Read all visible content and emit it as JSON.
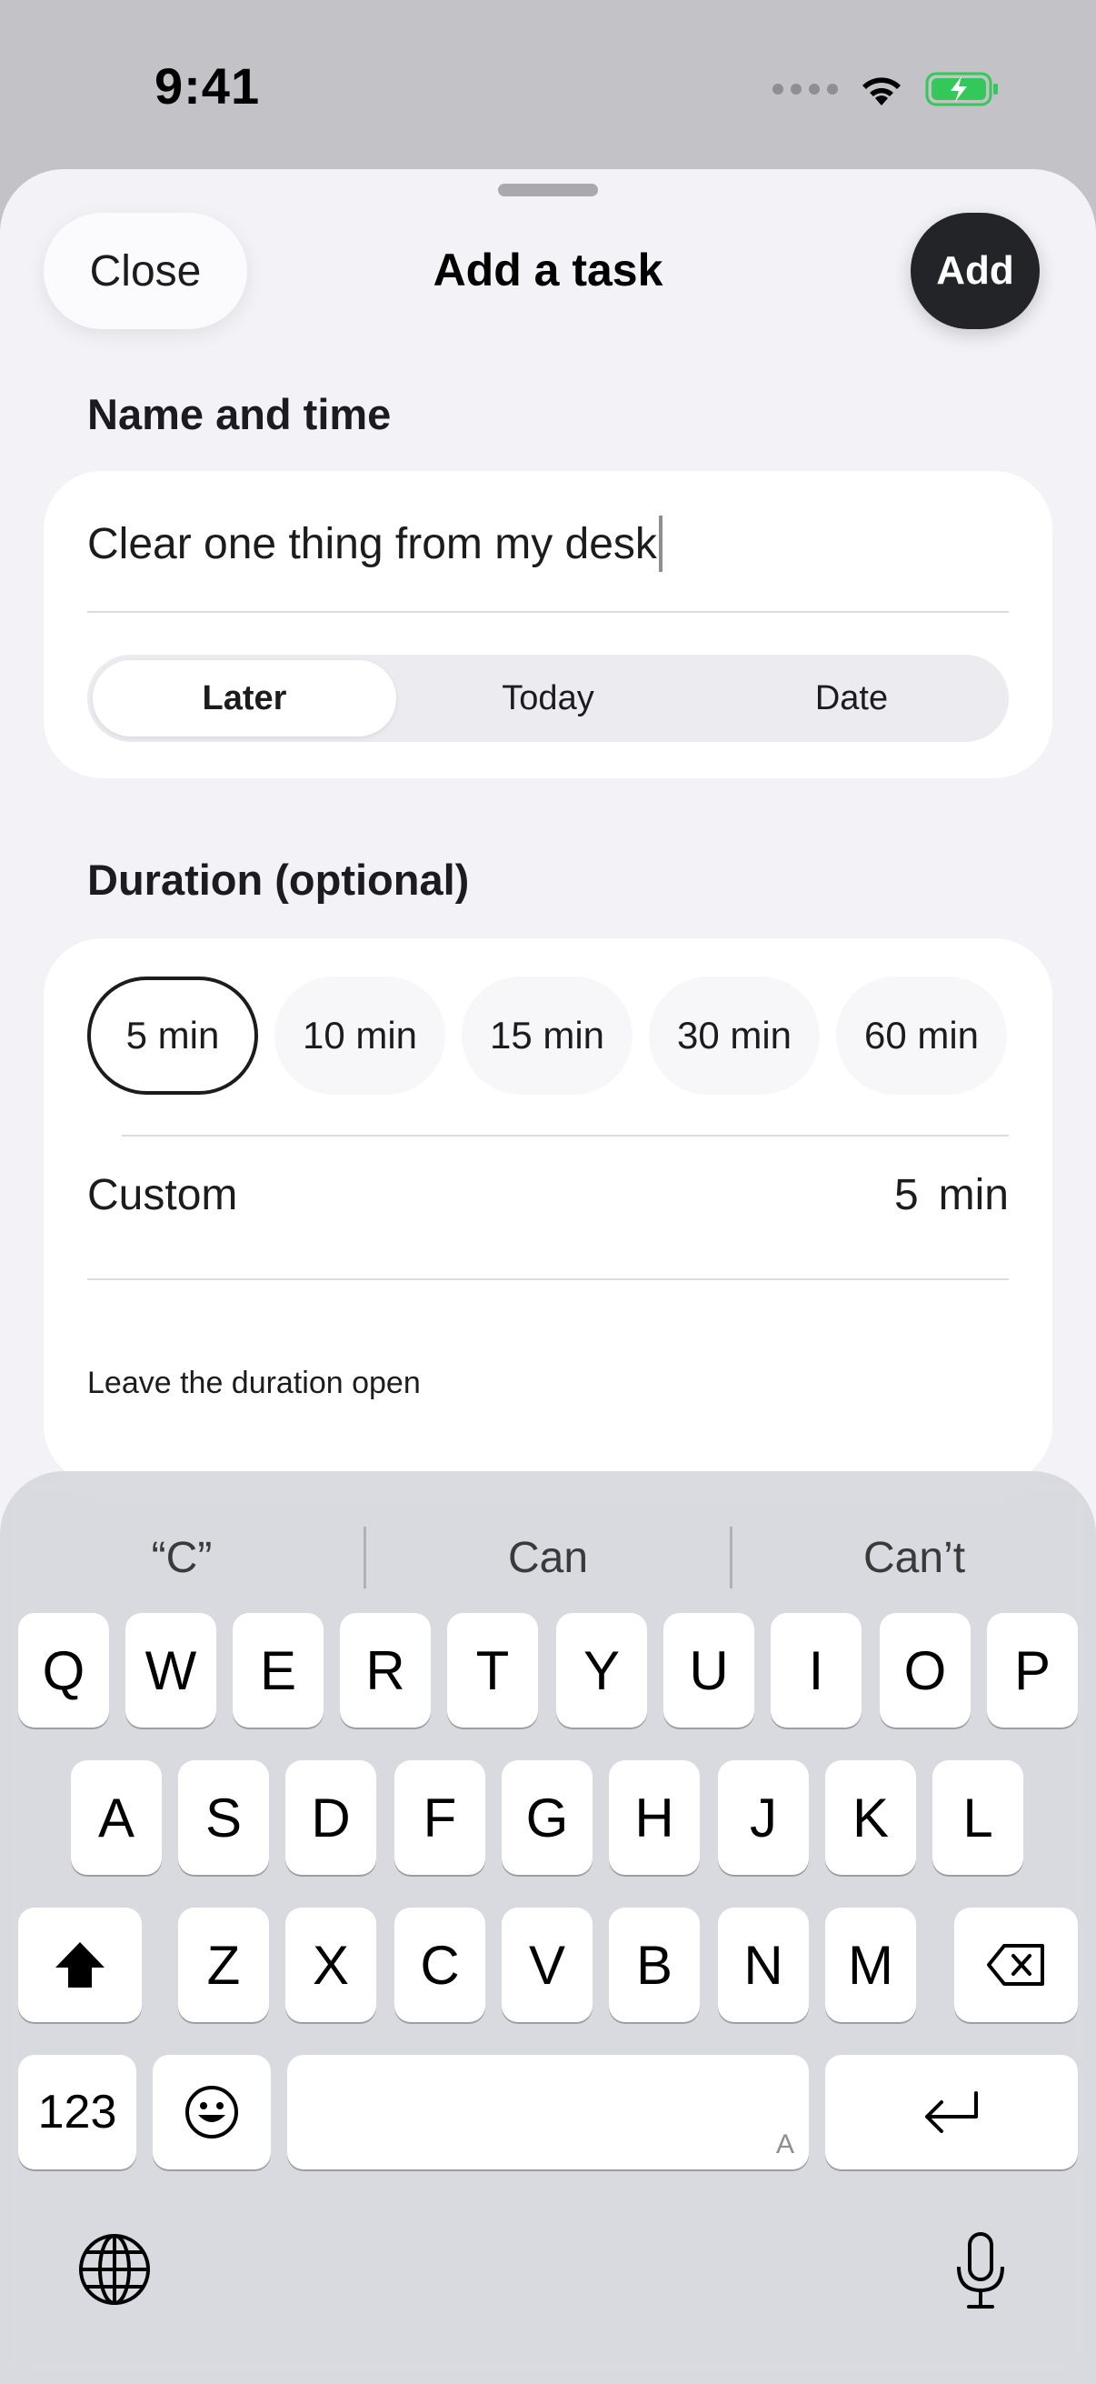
{
  "status_bar": {
    "time": "9:41"
  },
  "sheet": {
    "close_label": "Close",
    "title": "Add a task",
    "add_label": "Add"
  },
  "name_section": {
    "label": "Name and time",
    "task_value": "Clear one thing from my desk",
    "schedule_options": [
      "Later",
      "Today",
      "Date"
    ],
    "schedule_selected": "Later"
  },
  "duration_section": {
    "label": "Duration (optional)",
    "chips": [
      "5 min",
      "10 min",
      "15 min",
      "30 min",
      "60 min"
    ],
    "selected": "5 min",
    "custom_label": "Custom",
    "custom_number": "5",
    "custom_unit": "min",
    "open_label": "Leave the duration open"
  },
  "keyboard": {
    "suggestions": [
      "“C”",
      "Can",
      "Can’t"
    ],
    "row1": [
      "Q",
      "W",
      "E",
      "R",
      "T",
      "Y",
      "U",
      "I",
      "O",
      "P"
    ],
    "row2": [
      "A",
      "S",
      "D",
      "F",
      "G",
      "H",
      "J",
      "K",
      "L"
    ],
    "row3": [
      "Z",
      "X",
      "C",
      "V",
      "B",
      "N",
      "M"
    ],
    "numbers_label": "123",
    "space_hint": "A"
  },
  "colors": {
    "accent_dark": "#232427",
    "background": "#f2f2f7",
    "battery_green": "#34c759"
  },
  "icons": [
    "signal-dots-icon",
    "wifi-icon",
    "battery-charging-icon",
    "shift-icon",
    "backspace-icon",
    "emoji-icon",
    "return-icon",
    "globe-icon",
    "microphone-icon"
  ]
}
